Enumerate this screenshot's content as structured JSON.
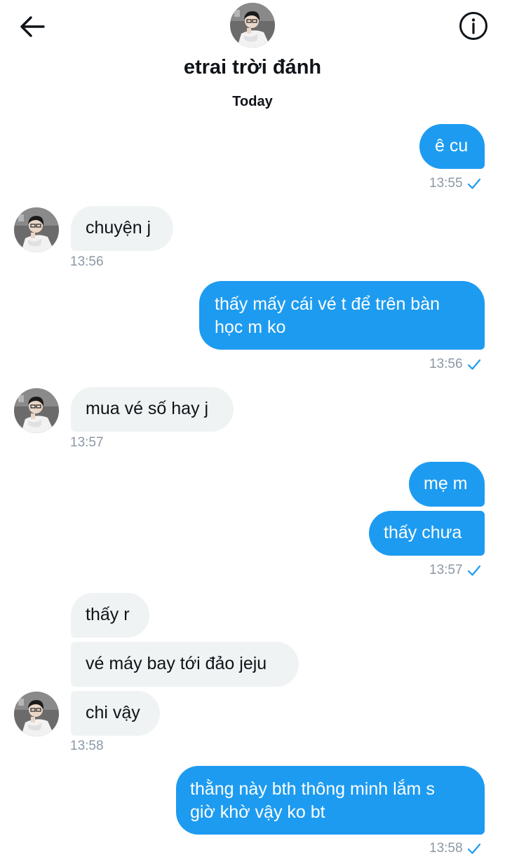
{
  "header": {
    "contact_name": "etrai trời đánh",
    "back_icon": "arrow-left-icon",
    "info_icon": "info-circle-icon"
  },
  "day_label": "Today",
  "messages": [
    {
      "dir": "sent",
      "text": "ê cu"
    },
    {
      "dir": "received",
      "text": "chuyện j"
    },
    {
      "dir": "sent",
      "lines": [
        "thấy mấy cái vé t để trên bàn",
        "học m ko"
      ]
    },
    {
      "dir": "received",
      "text": "mua vé số hay j"
    },
    {
      "dir": "sent",
      "text": "mẹ m"
    },
    {
      "dir": "sent",
      "text": "thấy chưa"
    },
    {
      "dir": "received",
      "text": "thấy r"
    },
    {
      "dir": "received",
      "text": "vé máy bay tới đảo jeju"
    },
    {
      "dir": "received",
      "text": "chi vậy"
    },
    {
      "dir": "sent",
      "lines": [
        "thằng này bth thông minh lắm s",
        "giờ khờ vậy ko bt"
      ]
    }
  ],
  "timestamps": [
    "13:55",
    "13:56",
    "13:56",
    "13:57",
    "13:57",
    "13:58",
    "13:58"
  ],
  "colors": {
    "sent_bubble": "#1d9bf0",
    "received_bubble": "#eff3f4",
    "timestamp": "#8b98a5",
    "check": "#1d9bf0"
  }
}
